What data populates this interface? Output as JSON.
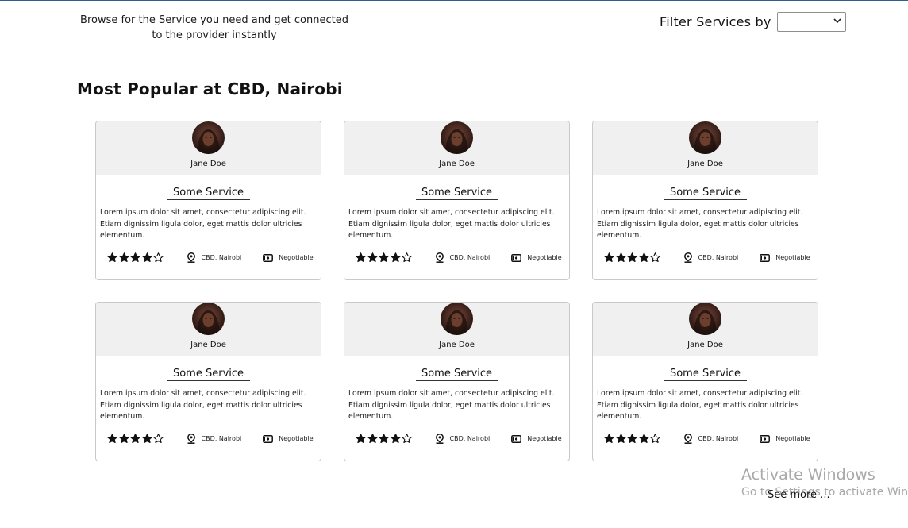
{
  "header": {
    "tagline": "Browse for the Service you need and get connected to the provider instantly",
    "filter_label": "Filter Services by",
    "filter_value": ""
  },
  "section": {
    "title": "Most Popular at CBD, Nairobi"
  },
  "cards": [
    {
      "name": "Jane Doe",
      "service": "Some Service",
      "description": "Lorem ipsum dolor sit amet, consectetur adipiscing elit. Etiam dignissim ligula dolor, eget mattis dolor ultricies elementum.",
      "rating": 4,
      "rating_max": 5,
      "location": "CBD, Nairobi",
      "price": "Negotiable"
    },
    {
      "name": "Jane Doe",
      "service": "Some Service",
      "description": "Lorem ipsum dolor sit amet, consectetur adipiscing elit. Etiam dignissim ligula dolor, eget mattis dolor ultricies elementum.",
      "rating": 4,
      "rating_max": 5,
      "location": "CBD, Nairobi",
      "price": "Negotiable"
    },
    {
      "name": "Jane Doe",
      "service": "Some Service",
      "description": "Lorem ipsum dolor sit amet, consectetur adipiscing elit. Etiam dignissim ligula dolor, eget mattis dolor ultricies elementum.",
      "rating": 4,
      "rating_max": 5,
      "location": "CBD, Nairobi",
      "price": "Negotiable"
    },
    {
      "name": "Jane Doe",
      "service": "Some Service",
      "description": "Lorem ipsum dolor sit amet, consectetur adipiscing elit. Etiam dignissim ligula dolor, eget mattis dolor ultricies elementum.",
      "rating": 4,
      "rating_max": 5,
      "location": "CBD, Nairobi",
      "price": "Negotiable"
    },
    {
      "name": "Jane Doe",
      "service": "Some Service",
      "description": "Lorem ipsum dolor sit amet, consectetur adipiscing elit. Etiam dignissim ligula dolor, eget mattis dolor ultricies elementum.",
      "rating": 4,
      "rating_max": 5,
      "location": "CBD, Nairobi",
      "price": "Negotiable"
    },
    {
      "name": "Jane Doe",
      "service": "Some Service",
      "description": "Lorem ipsum dolor sit amet, consectetur adipiscing elit. Etiam dignissim ligula dolor, eget mattis dolor ultricies elementum.",
      "rating": 4,
      "rating_max": 5,
      "location": "CBD, Nairobi",
      "price": "Negotiable"
    }
  ],
  "footer": {
    "see_more": "See more ..."
  },
  "watermark": {
    "title": "Activate Windows",
    "subtitle": "Go to Settings to activate Windows."
  },
  "icons": {
    "filled_star": "star-filled-icon",
    "empty_star": "star-outline-icon",
    "location": "map-pin-icon",
    "price": "cash-icon",
    "dropdown": "chevron-down-icon"
  }
}
